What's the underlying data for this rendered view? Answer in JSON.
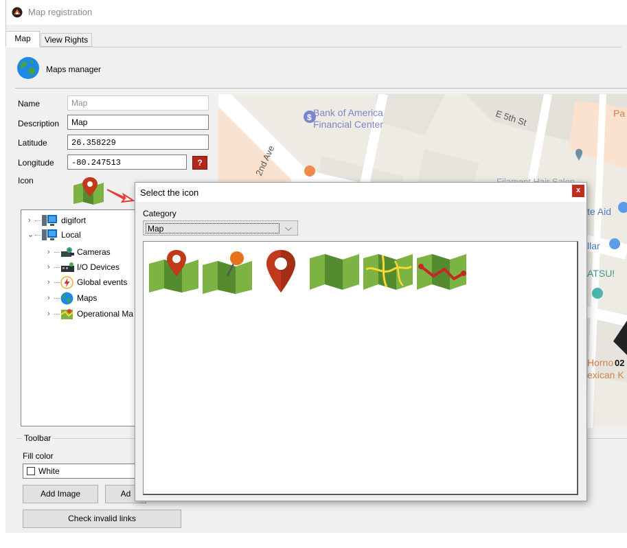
{
  "window": {
    "title": "Map registration",
    "tabs": [
      {
        "label": "Map",
        "active": true
      },
      {
        "label": "View Rights",
        "active": false
      }
    ]
  },
  "header": {
    "label": "Maps manager",
    "icon": "globe-icon"
  },
  "form": {
    "name_label": "Name",
    "name_value": "Map",
    "description_label": "Description",
    "description_value": "Map",
    "latitude_label": "Latitude",
    "latitude_value": "26.358229",
    "longitude_label": "Longitude",
    "longitude_value": "-80.247513",
    "geo_button": "?",
    "icon_label": "Icon"
  },
  "map_labels": {
    "poi1": "Bank of America",
    "poi1_line2": "Financial Center",
    "street1": "E 5th St",
    "street2": "2nd Ave",
    "partial1": "Pa",
    "partial2": "Filament Hair Salon",
    "partial3": "te Aid",
    "partial4": "llar",
    "partial5": "ATSU!",
    "partial6": "Horno",
    "partial7": "exican K",
    "partial8": "02"
  },
  "tree": {
    "items": [
      {
        "label": "digifort",
        "icon": "server-icon",
        "level": 0,
        "expanded": false
      },
      {
        "label": "Local",
        "icon": "server-icon",
        "level": 0,
        "expanded": true
      },
      {
        "label": "Cameras",
        "icon": "camera-icon",
        "level": 1,
        "expanded": false
      },
      {
        "label": "I/O Devices",
        "icon": "io-device-icon",
        "level": 1,
        "expanded": false
      },
      {
        "label": "Global events",
        "icon": "lightning-icon",
        "level": 1,
        "expanded": false
      },
      {
        "label": "Maps",
        "icon": "globe-icon",
        "level": 1,
        "expanded": false
      },
      {
        "label": "Operational Ma",
        "icon": "map-icon",
        "level": 1,
        "expanded": false
      }
    ]
  },
  "toolbar": {
    "caption": "Toolbar",
    "fill_color_label": "Fill color",
    "fill_color_value": "White",
    "add_image_label": "Add Image",
    "add_second_label": "Ad",
    "check_links_label": "Check invalid links"
  },
  "dialog": {
    "title": "Select the icon",
    "close_label": "x",
    "category_label": "Category",
    "category_value": "Map",
    "icons": [
      "map-with-pin-icon",
      "map-with-pushpin-icon",
      "location-pin-icon",
      "folded-map-icon",
      "map-roads-icon",
      "map-route-icon"
    ]
  },
  "colors": {
    "map_green": "#7cb342",
    "map_green_dark": "#558b2f",
    "pin_red": "#c0391b",
    "pin_orange": "#e8711c",
    "close_red": "#c42b1c",
    "map_bg": "#f2efe9"
  }
}
